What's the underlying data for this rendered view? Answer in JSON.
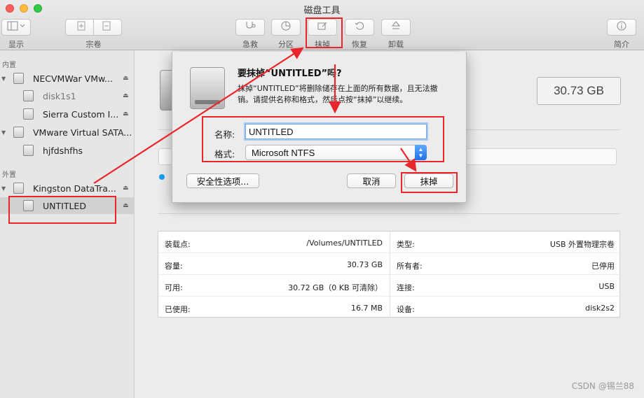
{
  "window": {
    "title": "磁盘工具"
  },
  "toolbar": {
    "display_label": "显示",
    "volume_label": "宗卷",
    "first_aid_label": "急救",
    "partition_label": "分区",
    "erase_label": "抹掉",
    "restore_label": "恢复",
    "unmount_label": "卸载",
    "info_label": "简介"
  },
  "sidebar": {
    "internal_header": "内置",
    "external_header": "外置",
    "items": [
      {
        "label": "NECVMWar VMw..."
      },
      {
        "label": "disk1s1"
      },
      {
        "label": "Sierra Custom I..."
      },
      {
        "label": "VMware Virtual SATA..."
      },
      {
        "label": "hjfdshfhs"
      },
      {
        "label": "Kingston DataTra..."
      },
      {
        "label": "UNTITLED"
      }
    ]
  },
  "main": {
    "capacity_display": "30.73 GB",
    "info": {
      "left": [
        {
          "key": "装载点:",
          "value": "/Volumes/UNTITLED"
        },
        {
          "key": "容量:",
          "value": "30.73 GB"
        },
        {
          "key": "可用:",
          "value": "30.72 GB（0 KB 可清除）"
        },
        {
          "key": "已使用:",
          "value": "16.7 MB"
        }
      ],
      "right": [
        {
          "key": "类型:",
          "value": "USB 外置物理宗卷"
        },
        {
          "key": "所有者:",
          "value": "已停用"
        },
        {
          "key": "连接:",
          "value": "USB"
        },
        {
          "key": "设备:",
          "value": "disk2s2"
        }
      ]
    }
  },
  "dialog": {
    "title": "要抹掉“UNTITLED”吗?",
    "description": "抹掉“UNTITLED”将删除储存在上面的所有数据，且无法撤销。请提供名称和格式，然后点按“抹掉”以继续。",
    "name_label": "名称:",
    "name_value": "UNTITLED",
    "format_label": "格式:",
    "format_value": "Microsoft NTFS",
    "security_button": "安全性选项...",
    "cancel_button": "取消",
    "erase_button": "抹掉"
  },
  "watermark": "CSDN @锡兰88",
  "colors": {
    "annotation_red": "#e8262b",
    "selection_blue": "#1f73e8"
  }
}
